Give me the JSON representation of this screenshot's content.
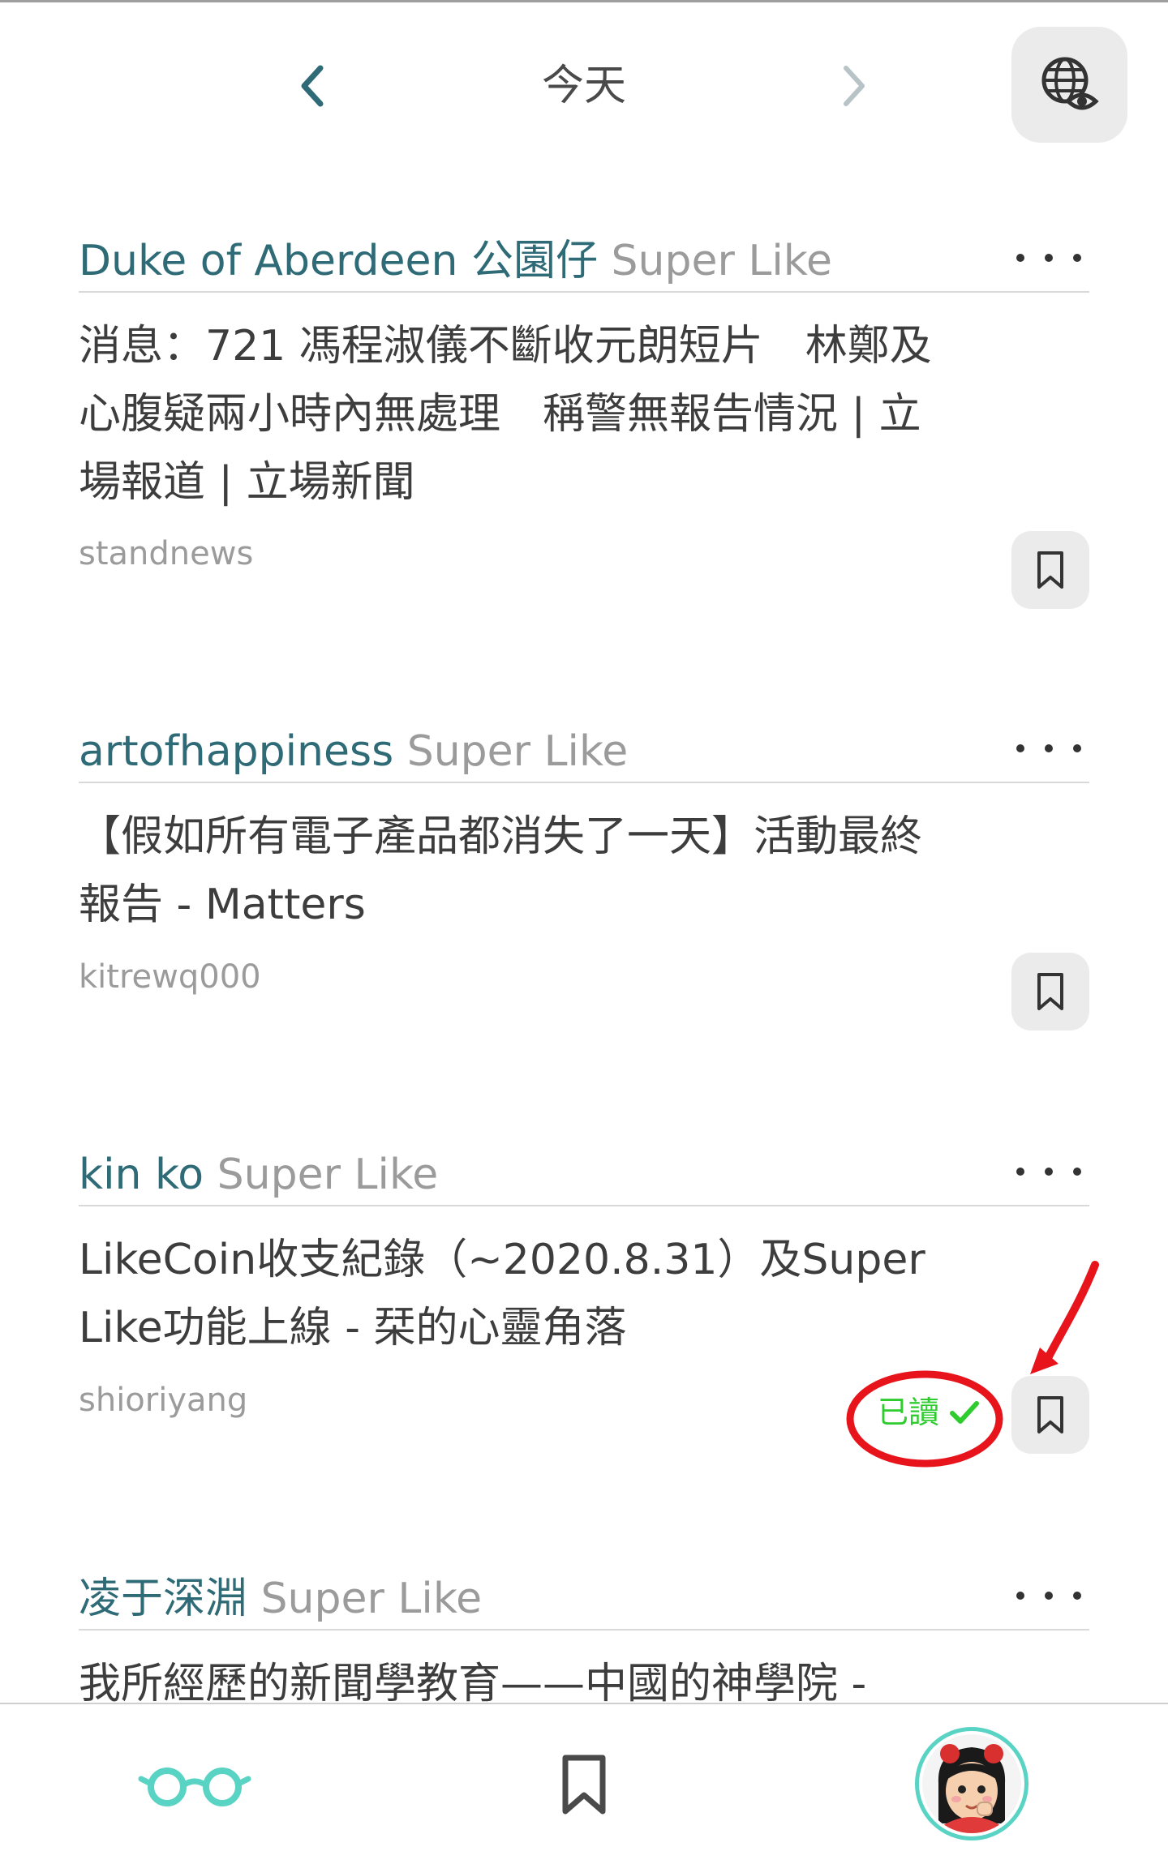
{
  "header": {
    "title": "今天"
  },
  "colors": {
    "accent": "#2e6b76",
    "muted": "#9b9b9b",
    "teal": "#59d3c3",
    "read_green": "#2fcc2f",
    "annotation_red": "#e8141c"
  },
  "feed": {
    "items": [
      {
        "liker": "Duke of Aberdeen 公園仔",
        "tag": "Super Like",
        "title_lines": [
          "消息：721 馮程淑儀不斷收元朗短片　林鄭及",
          "心腹疑兩小時內無處理　稱警無報告情況 | 立",
          "場報道 | 立場新聞"
        ],
        "source": "standnews"
      },
      {
        "liker": "artofhappiness",
        "tag": "Super Like",
        "title_lines": [
          "【假如所有電子產品都消失了一天】活動最終",
          "報告 - Matters"
        ],
        "source": "kitrewq000"
      },
      {
        "liker": "kin ko",
        "tag": "Super Like",
        "title_lines": [
          "LikeCoin收支紀錄（~2020.8.31）及Super",
          "Like功能上線 - 栞的心靈角落"
        ],
        "source": "shioriyang",
        "read_label": "已讀",
        "read_icon": "check-icon"
      },
      {
        "liker": "凌于深淵",
        "tag": "Super Like",
        "title_lines": [
          "我所經歷的新聞學教育——中國的神學院 -"
        ],
        "source": ""
      }
    ]
  },
  "bottom_nav": {
    "tabs": [
      {
        "icon": "glasses-icon",
        "active": true
      },
      {
        "icon": "bookmark-icon",
        "active": false
      },
      {
        "icon": "avatar",
        "active": false
      }
    ]
  }
}
